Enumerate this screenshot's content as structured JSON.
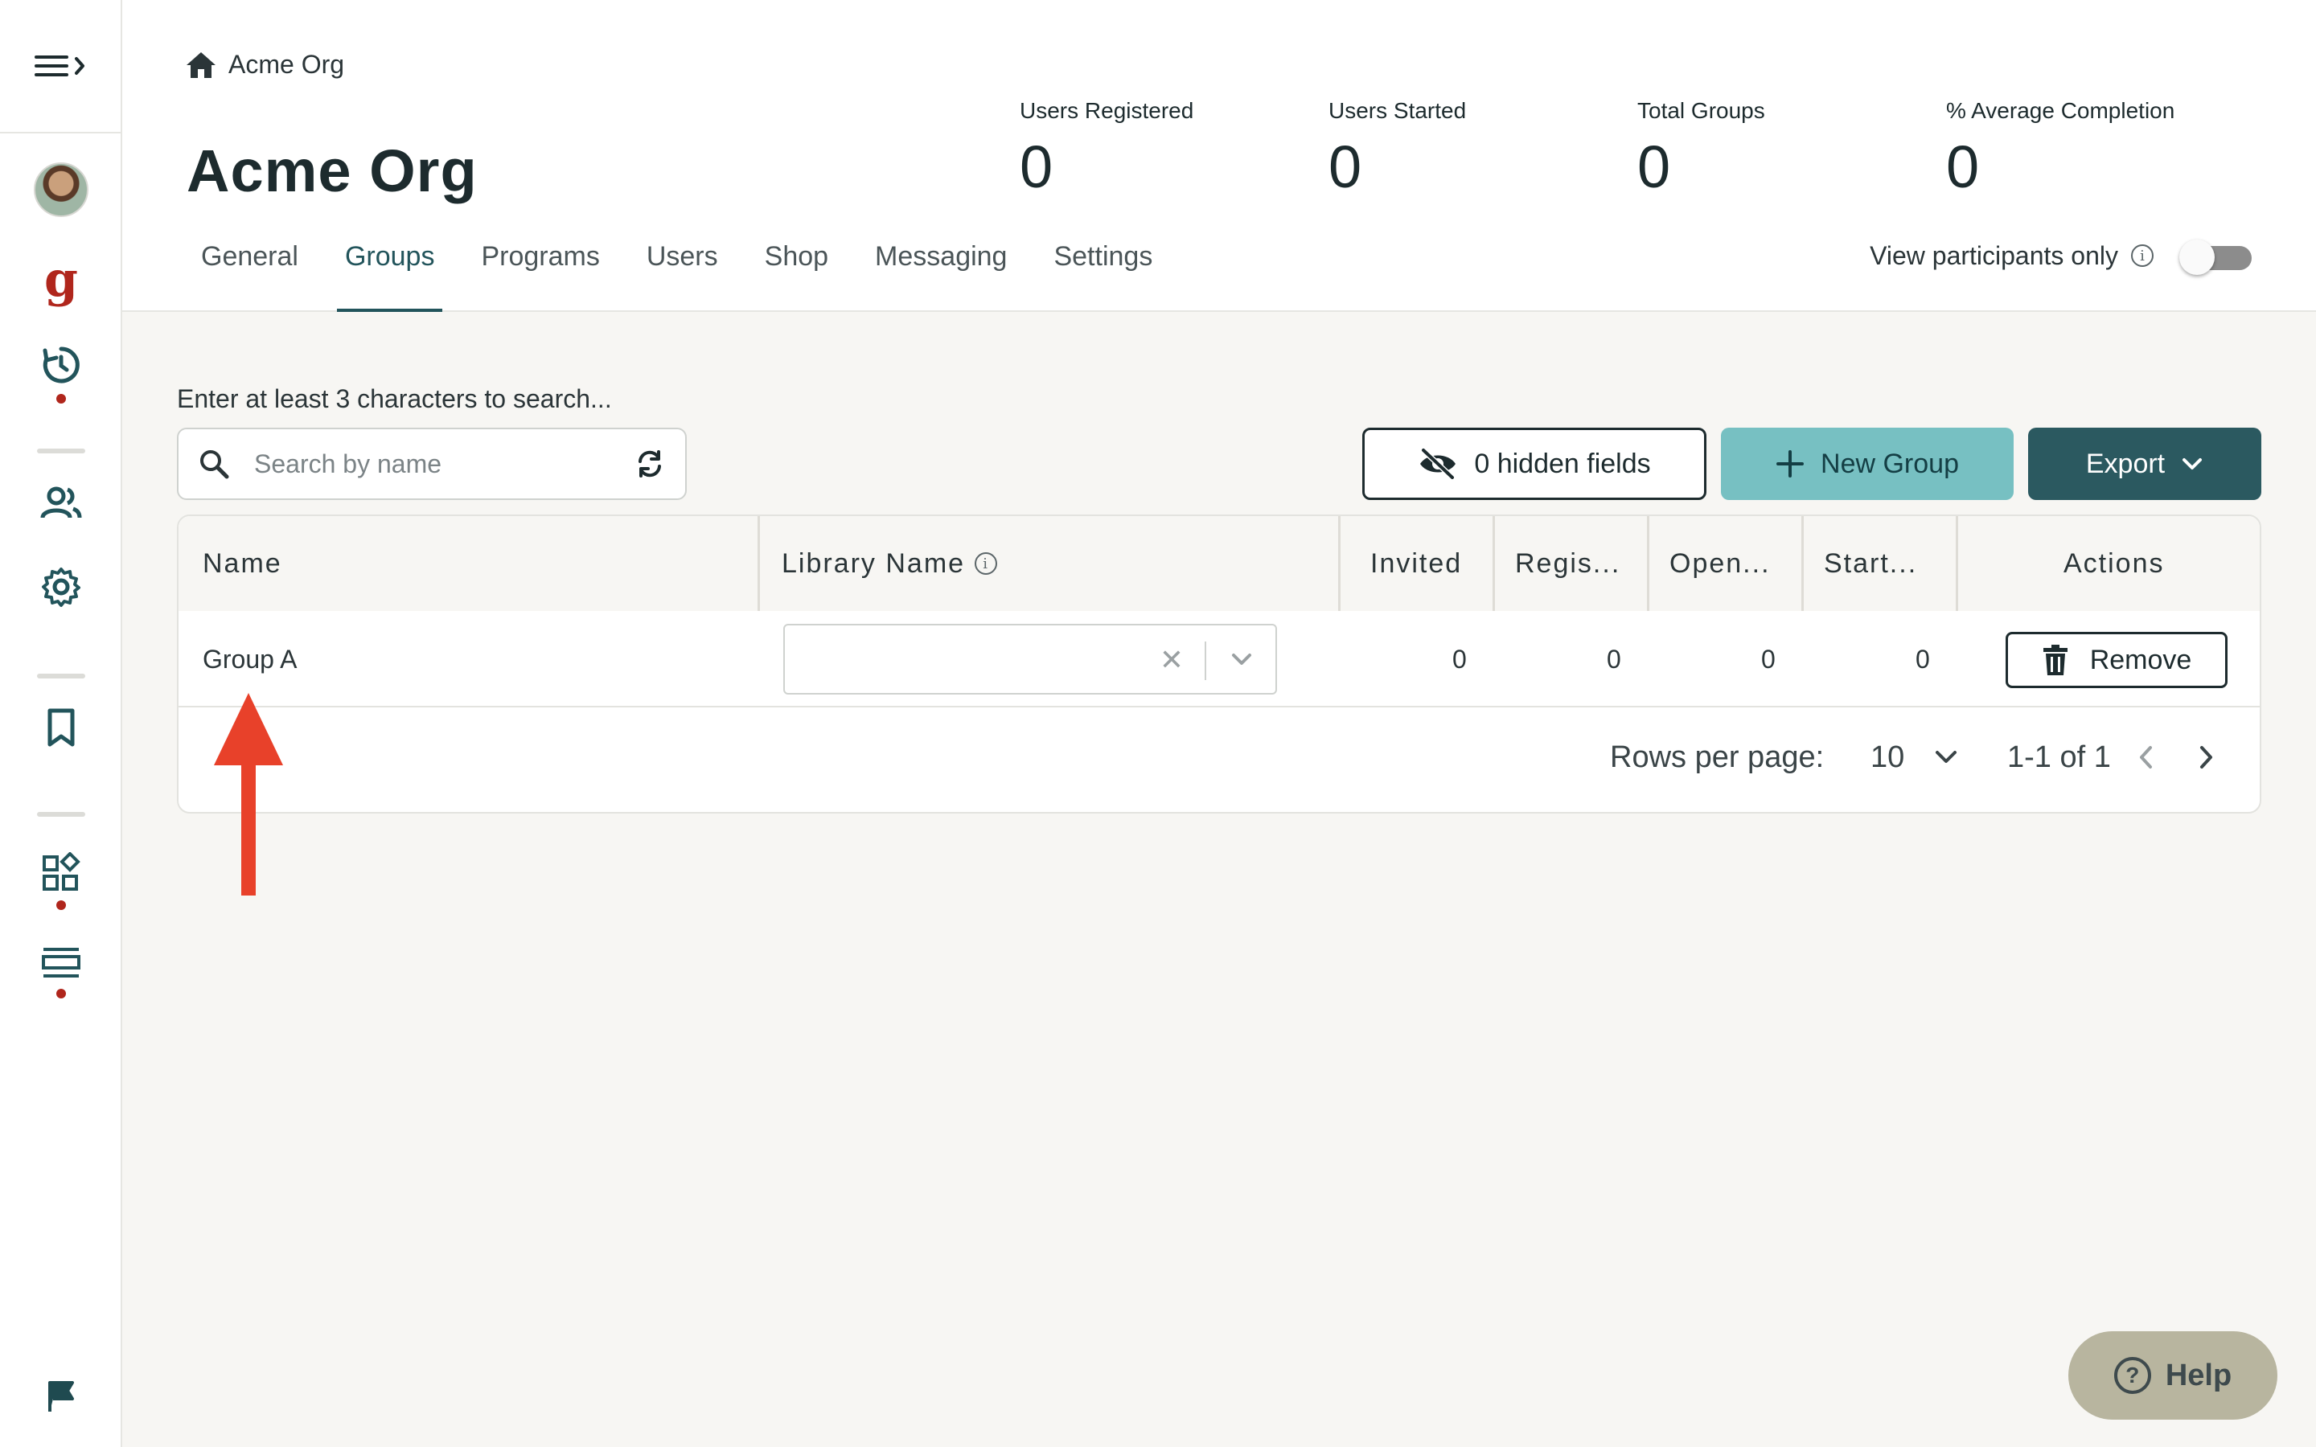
{
  "breadcrumb": {
    "label": "Acme Org"
  },
  "page": {
    "title": "Acme Org"
  },
  "stats": [
    {
      "label": "Users Registered",
      "value": "0"
    },
    {
      "label": "Users Started",
      "value": "0"
    },
    {
      "label": "Total Groups",
      "value": "0"
    },
    {
      "label": "% Average Completion",
      "value": "0"
    }
  ],
  "tabs": [
    {
      "label": "General"
    },
    {
      "label": "Groups",
      "active": true
    },
    {
      "label": "Programs"
    },
    {
      "label": "Users"
    },
    {
      "label": "Shop"
    },
    {
      "label": "Messaging"
    },
    {
      "label": "Settings"
    }
  ],
  "participants_toggle": {
    "label": "View participants only",
    "on": false
  },
  "search": {
    "hint": "Enter at least 3 characters to search...",
    "placeholder": "Search by name"
  },
  "toolbar": {
    "hidden_fields_label": "0 hidden fields",
    "new_group_label": "New Group",
    "export_label": "Export"
  },
  "table": {
    "columns": [
      "Name",
      "Library Name",
      "Invited",
      "Regis...",
      "Open...",
      "Start...",
      "Actions"
    ],
    "rows": [
      {
        "name": "Group A",
        "library": "",
        "invited": "0",
        "registered": "0",
        "opened": "0",
        "started": "0",
        "action": "Remove"
      }
    ],
    "pagination": {
      "rows_per_page_label": "Rows per page:",
      "rows_per_page": "10",
      "range": "1-1 of 1"
    }
  },
  "help": {
    "label": "Help"
  },
  "colors": {
    "primary": "#2b5960",
    "accent": "#77c0c2",
    "alert_red": "#b0261c",
    "arrow_red": "#e8412a",
    "help_bg": "#b8b59f"
  },
  "icons": [
    "menu-icon",
    "chevron-right-icon",
    "home-icon",
    "history-icon",
    "people-icon",
    "gear-icon",
    "bookmark-icon",
    "widgets-icon",
    "list-icon",
    "flag-icon",
    "search-icon",
    "refresh-icon",
    "eye-off-icon",
    "plus-icon",
    "chevron-down-icon",
    "info-icon",
    "trash-icon",
    "help-icon"
  ]
}
